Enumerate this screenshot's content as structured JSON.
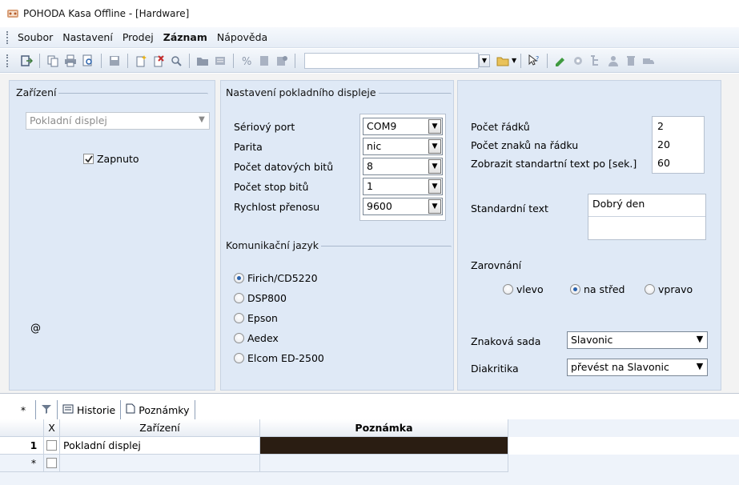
{
  "window": {
    "title": "POHODA Kasa Offline - [Hardware]"
  },
  "menu": {
    "items": [
      "Soubor",
      "Nastavení",
      "Prodej",
      "Záznam",
      "Nápověda"
    ]
  },
  "device": {
    "group_label": "Zařízení",
    "selected_device": "Pokladní displej",
    "enabled_label": "Zapnuto",
    "enabled": true,
    "at_symbol": "@"
  },
  "display_settings": {
    "group_label": "Nastavení pokladního displeje",
    "serial_port_label": "Sériový port",
    "serial_port": "COM9",
    "parity_label": "Parita",
    "parity": "nic",
    "data_bits_label": "Počet datových bitů",
    "data_bits": "8",
    "stop_bits_label": "Počet stop bitů",
    "stop_bits": "1",
    "baud_label": "Rychlost přenosu",
    "baud": "9600"
  },
  "language": {
    "group_label": "Komunikační jazyk",
    "options": [
      "Firich/CD5220",
      "DSP800",
      "Epson",
      "Aedex",
      "Elcom ED-2500"
    ],
    "selected_index": 0
  },
  "display_text": {
    "rows_label": "Počet řádků",
    "rows": "2",
    "chars_label": "Počet znaků na řádku",
    "chars": "20",
    "show_std_label": "Zobrazit standartní text po [sek.]",
    "show_std": "60",
    "std_text_label": "Standardní text",
    "std_text_line1": "Dobrý den",
    "std_text_line2": "",
    "alignment_label": "Zarovnání",
    "alignment_options": [
      "vlevo",
      "na střed",
      "vpravo"
    ],
    "alignment_selected": 1,
    "charset_label": "Znaková sada",
    "charset": "Slavonic",
    "diacritics_label": "Diakritika",
    "diacritics": "převést na Slavonic"
  },
  "tabs": {
    "star": "*",
    "history": "Historie",
    "notes": "Poznámky"
  },
  "grid": {
    "columns": [
      "X",
      "Zařízení",
      "Poznámka"
    ],
    "rows": [
      {
        "indicator": "1",
        "device": "Pokladní displej",
        "note": ""
      },
      {
        "indicator": "*",
        "device": "",
        "note": ""
      }
    ]
  },
  "colors": {
    "accent": "#2a62ad",
    "panel": "#dfe9f6",
    "note_cell": "#2a1d12"
  }
}
